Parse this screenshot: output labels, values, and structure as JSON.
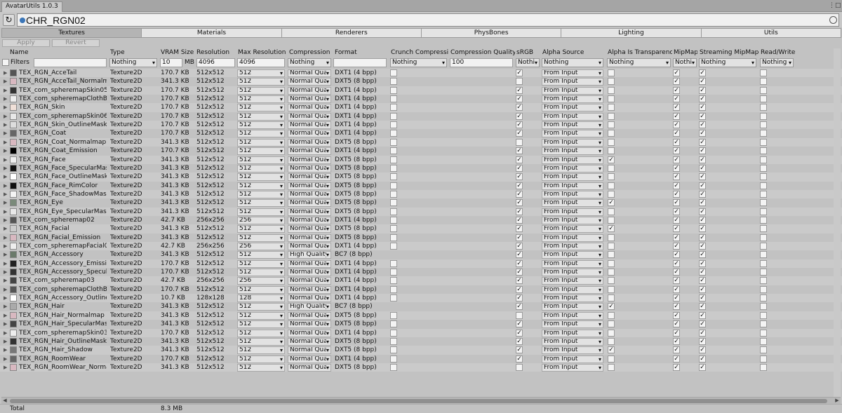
{
  "window": {
    "title": "AvatarUtils 1.0.3",
    "menu_icon": "kebab-menu-icon"
  },
  "toolbar": {
    "refresh_icon": "refresh-icon",
    "object_name": "CHR_RGN02"
  },
  "tabs": [
    "Textures",
    "Materials",
    "Renderers",
    "PhysBones",
    "Lighting",
    "Utils"
  ],
  "actions": {
    "apply": "Apply",
    "revert": "Revert"
  },
  "columns": {
    "name": "Name",
    "type": "Type",
    "vram": "VRAM Size",
    "resolution": "Resolution",
    "max_resolution": "Max Resolution",
    "compression": "Compression",
    "format": "Format",
    "crunch": "Crunch Compression",
    "quality": "Compression Quality",
    "srgb": "sRGB",
    "alpha_source": "Alpha Source",
    "alpha_transparency": "Alpha Is Transparency",
    "mipmap": "MipMap",
    "streaming": "Streaming MipMaps",
    "readwrite": "Read/Write"
  },
  "filters": {
    "label": "Filters",
    "type": "Nothing",
    "vram_value": "10",
    "vram_unit": "MB",
    "resolution": "4096",
    "max_resolution": "4096",
    "compression": "Nothing",
    "crunch": "Nothing",
    "quality": "100",
    "srgb": "Nothi",
    "alpha_source": "Nothing",
    "alpha_transparency": "Nothing",
    "mipmap": "Nothi",
    "streaming": "Nothing",
    "readwrite": "Nothing"
  },
  "rows": [
    {
      "name": "TEX_RGN_AcceTail",
      "type": "Texture2D",
      "vram": "170.7 KB",
      "res": "512x512",
      "max": "512",
      "comp": "Normal Qua",
      "format": "DXT1 (4 bpp)",
      "crunch": false,
      "srgb": true,
      "alpha": "From Input",
      "alphaT": false,
      "mip": true,
      "stream": true,
      "rw": false,
      "thumb": "#555"
    },
    {
      "name": "TEX_RGN_AcceTail_Normalma",
      "type": "Texture2D",
      "vram": "341.3 KB",
      "res": "512x512",
      "max": "512",
      "comp": "Normal Qua",
      "format": "DXT5 (8 bpp)",
      "crunch": false,
      "srgb": false,
      "alpha": "From Input",
      "alphaT": false,
      "mip": true,
      "stream": true,
      "rw": false,
      "thumb": "#d8b8c0"
    },
    {
      "name": "TEX_com_spheremapSkin05",
      "type": "Texture2D",
      "vram": "170.7 KB",
      "res": "512x512",
      "max": "512",
      "comp": "Normal Qua",
      "format": "DXT1 (4 bpp)",
      "crunch": false,
      "srgb": true,
      "alpha": "From Input",
      "alphaT": false,
      "mip": true,
      "stream": true,
      "rw": false,
      "thumb": "#333"
    },
    {
      "name": "TEX_com_spheremapClothBlue",
      "type": "Texture2D",
      "vram": "170.7 KB",
      "res": "512x512",
      "max": "512",
      "comp": "Normal Qua",
      "format": "DXT1 (4 bpp)",
      "crunch": false,
      "srgb": true,
      "alpha": "From Input",
      "alphaT": false,
      "mip": true,
      "stream": true,
      "rw": false,
      "thumb": "#eee"
    },
    {
      "name": "TEX_RGN_Skin",
      "type": "Texture2D",
      "vram": "170.7 KB",
      "res": "512x512",
      "max": "512",
      "comp": "Normal Qua",
      "format": "DXT1 (4 bpp)",
      "crunch": false,
      "srgb": true,
      "alpha": "From Input",
      "alphaT": false,
      "mip": true,
      "stream": true,
      "rw": false,
      "thumb": "#f0e0d8"
    },
    {
      "name": "TEX_com_spheremapSkin06",
      "type": "Texture2D",
      "vram": "170.7 KB",
      "res": "512x512",
      "max": "512",
      "comp": "Normal Qua",
      "format": "DXT1 (4 bpp)",
      "crunch": false,
      "srgb": true,
      "alpha": "From Input",
      "alphaT": false,
      "mip": true,
      "stream": true,
      "rw": false,
      "thumb": "#e8e8e8"
    },
    {
      "name": "TEX_RGN_Skin_OutlineMask",
      "type": "Texture2D",
      "vram": "170.7 KB",
      "res": "512x512",
      "max": "512",
      "comp": "Normal Qua",
      "format": "DXT1 (4 bpp)",
      "crunch": false,
      "srgb": true,
      "alpha": "From Input",
      "alphaT": false,
      "mip": true,
      "stream": true,
      "rw": false,
      "thumb": "#ddd"
    },
    {
      "name": "TEX_RGN_Coat",
      "type": "Texture2D",
      "vram": "170.7 KB",
      "res": "512x512",
      "max": "512",
      "comp": "Normal Qua",
      "format": "DXT1 (4 bpp)",
      "crunch": false,
      "srgb": true,
      "alpha": "From Input",
      "alphaT": false,
      "mip": true,
      "stream": true,
      "rw": false,
      "thumb": "#666"
    },
    {
      "name": "TEX_RGN_Coat_Normalmap",
      "type": "Texture2D",
      "vram": "341.3 KB",
      "res": "512x512",
      "max": "512",
      "comp": "Normal Qua",
      "format": "DXT5 (8 bpp)",
      "crunch": false,
      "srgb": false,
      "alpha": "From Input",
      "alphaT": false,
      "mip": true,
      "stream": true,
      "rw": false,
      "thumb": "#d8b8c0"
    },
    {
      "name": "TEX_RGN_Coat_Emission",
      "type": "Texture2D",
      "vram": "170.7 KB",
      "res": "512x512",
      "max": "512",
      "comp": "Normal Qua",
      "format": "DXT1 (4 bpp)",
      "crunch": false,
      "srgb": true,
      "alpha": "From Input",
      "alphaT": false,
      "mip": true,
      "stream": true,
      "rw": false,
      "thumb": "#000"
    },
    {
      "name": "TEX_RGN_Face",
      "type": "Texture2D",
      "vram": "341.3 KB",
      "res": "512x512",
      "max": "512",
      "comp": "Normal Qua",
      "format": "DXT5 (8 bpp)",
      "crunch": false,
      "srgb": true,
      "alpha": "From Input",
      "alphaT": true,
      "mip": true,
      "stream": true,
      "rw": false,
      "thumb": "#eee"
    },
    {
      "name": "TEX_RGN_Face_SpecularMask",
      "type": "Texture2D",
      "vram": "341.3 KB",
      "res": "512x512",
      "max": "512",
      "comp": "Normal Qua",
      "format": "DXT5 (8 bpp)",
      "crunch": false,
      "srgb": true,
      "alpha": "From Input",
      "alphaT": false,
      "mip": true,
      "stream": true,
      "rw": false,
      "thumb": "#111"
    },
    {
      "name": "TEX_RGN_Face_OutlineMask",
      "type": "Texture2D",
      "vram": "341.3 KB",
      "res": "512x512",
      "max": "512",
      "comp": "Normal Qua",
      "format": "DXT5 (8 bpp)",
      "crunch": false,
      "srgb": true,
      "alpha": "From Input",
      "alphaT": false,
      "mip": true,
      "stream": true,
      "rw": false,
      "thumb": "#fff"
    },
    {
      "name": "TEX_RGN_Face_RimColor",
      "type": "Texture2D",
      "vram": "341.3 KB",
      "res": "512x512",
      "max": "512",
      "comp": "Normal Qua",
      "format": "DXT5 (8 bpp)",
      "crunch": false,
      "srgb": true,
      "alpha": "From Input",
      "alphaT": false,
      "mip": true,
      "stream": true,
      "rw": false,
      "thumb": "#111"
    },
    {
      "name": "TEX_RGN_Face_ShadowMask",
      "type": "Texture2D",
      "vram": "341.3 KB",
      "res": "512x512",
      "max": "512",
      "comp": "Normal Qua",
      "format": "DXT5 (8 bpp)",
      "crunch": false,
      "srgb": true,
      "alpha": "From Input",
      "alphaT": false,
      "mip": true,
      "stream": true,
      "rw": false,
      "thumb": "#f4f4f4"
    },
    {
      "name": "TEX_RGN_Eye",
      "type": "Texture2D",
      "vram": "341.3 KB",
      "res": "512x512",
      "max": "512",
      "comp": "Normal Qua",
      "format": "DXT5 (8 bpp)",
      "crunch": false,
      "srgb": true,
      "alpha": "From Input",
      "alphaT": true,
      "mip": true,
      "stream": true,
      "rw": false,
      "thumb": "#7a8a7a"
    },
    {
      "name": "TEX_RGN_Eye_SpecularMask",
      "type": "Texture2D",
      "vram": "341.3 KB",
      "res": "512x512",
      "max": "512",
      "comp": "Normal Qua",
      "format": "DXT5 (8 bpp)",
      "crunch": false,
      "srgb": true,
      "alpha": "From Input",
      "alphaT": false,
      "mip": true,
      "stream": true,
      "rw": false,
      "thumb": "#e8e8e8"
    },
    {
      "name": "TEX_com_spheremap02",
      "type": "Texture2D",
      "vram": "42.7 KB",
      "res": "256x256",
      "max": "256",
      "comp": "Normal Qua",
      "format": "DXT1 (4 bpp)",
      "crunch": false,
      "srgb": true,
      "alpha": "From Input",
      "alphaT": false,
      "mip": true,
      "stream": true,
      "rw": false,
      "thumb": "#555"
    },
    {
      "name": "TEX_RGN_Facial",
      "type": "Texture2D",
      "vram": "341.3 KB",
      "res": "512x512",
      "max": "512",
      "comp": "Normal Qua",
      "format": "DXT5 (8 bpp)",
      "crunch": false,
      "srgb": true,
      "alpha": "From Input",
      "alphaT": true,
      "mip": true,
      "stream": true,
      "rw": false,
      "thumb": "#ccc"
    },
    {
      "name": "TEX_RGN_Facial_Emission",
      "type": "Texture2D",
      "vram": "341.3 KB",
      "res": "512x512",
      "max": "512",
      "comp": "Normal Qua",
      "format": "DXT5 (8 bpp)",
      "crunch": false,
      "srgb": true,
      "alpha": "From Input",
      "alphaT": false,
      "mip": true,
      "stream": true,
      "rw": false,
      "thumb": "#d8b8c0"
    },
    {
      "name": "TEX_com_spheremapFacial01",
      "type": "Texture2D",
      "vram": "42.7 KB",
      "res": "256x256",
      "max": "256",
      "comp": "Normal Qua",
      "format": "DXT1 (4 bpp)",
      "crunch": false,
      "srgb": true,
      "alpha": "From Input",
      "alphaT": false,
      "mip": true,
      "stream": true,
      "rw": false,
      "thumb": "#eee"
    },
    {
      "name": "TEX_RGN_Accessory",
      "type": "Texture2D",
      "vram": "341.3 KB",
      "res": "512x512",
      "max": "512",
      "comp": "High Quality",
      "format": "BC7 (8 bpp)",
      "crunch": null,
      "srgb": true,
      "alpha": "From Input",
      "alphaT": false,
      "mip": true,
      "stream": true,
      "rw": false,
      "thumb": "#6a7a6a"
    },
    {
      "name": "TEX_RGN_Accessory_Emission",
      "type": "Texture2D",
      "vram": "170.7 KB",
      "res": "512x512",
      "max": "512",
      "comp": "Normal Qua",
      "format": "DXT1 (4 bpp)",
      "crunch": false,
      "srgb": true,
      "alpha": "From Input",
      "alphaT": false,
      "mip": true,
      "stream": true,
      "rw": false,
      "thumb": "#222"
    },
    {
      "name": "TEX_RGN_Accessory_Specular",
      "type": "Texture2D",
      "vram": "170.7 KB",
      "res": "512x512",
      "max": "512",
      "comp": "Normal Qua",
      "format": "DXT1 (4 bpp)",
      "crunch": false,
      "srgb": true,
      "alpha": "From Input",
      "alphaT": false,
      "mip": true,
      "stream": true,
      "rw": false,
      "thumb": "#333"
    },
    {
      "name": "TEX_com_spheremap03",
      "type": "Texture2D",
      "vram": "42.7 KB",
      "res": "256x256",
      "max": "256",
      "comp": "Normal Qua",
      "format": "DXT1 (4 bpp)",
      "crunch": false,
      "srgb": true,
      "alpha": "From Input",
      "alphaT": false,
      "mip": true,
      "stream": true,
      "rw": false,
      "thumb": "#444"
    },
    {
      "name": "TEX_com_spheremapClothBlue",
      "type": "Texture2D",
      "vram": "170.7 KB",
      "res": "512x512",
      "max": "512",
      "comp": "Normal Qua",
      "format": "DXT1 (4 bpp)",
      "crunch": false,
      "srgb": true,
      "alpha": "From Input",
      "alphaT": false,
      "mip": true,
      "stream": true,
      "rw": false,
      "thumb": "#555"
    },
    {
      "name": "TEX_RGN_Accessory_OutlineMa",
      "type": "Texture2D",
      "vram": "10.7 KB",
      "res": "128x128",
      "max": "128",
      "comp": "Normal Qua",
      "format": "DXT1 (4 bpp)",
      "crunch": false,
      "srgb": true,
      "alpha": "From Input",
      "alphaT": false,
      "mip": true,
      "stream": true,
      "rw": false,
      "thumb": "#fff"
    },
    {
      "name": "TEX_RGN_Hair",
      "type": "Texture2D",
      "vram": "341.3 KB",
      "res": "512x512",
      "max": "512",
      "comp": "High Quality",
      "format": "BC7 (8 bpp)",
      "crunch": null,
      "srgb": true,
      "alpha": "From Input",
      "alphaT": true,
      "mip": true,
      "stream": true,
      "rw": false,
      "thumb": "#aaa"
    },
    {
      "name": "TEX_RGN_Hair_Normalmap",
      "type": "Texture2D",
      "vram": "341.3 KB",
      "res": "512x512",
      "max": "512",
      "comp": "Normal Qua",
      "format": "DXT5 (8 bpp)",
      "crunch": false,
      "srgb": false,
      "alpha": "From Input",
      "alphaT": false,
      "mip": true,
      "stream": true,
      "rw": false,
      "thumb": "#d8b8c0"
    },
    {
      "name": "TEX_RGN_Hair_SpecularMask",
      "type": "Texture2D",
      "vram": "341.3 KB",
      "res": "512x512",
      "max": "512",
      "comp": "Normal Qua",
      "format": "DXT5 (8 bpp)",
      "crunch": false,
      "srgb": true,
      "alpha": "From Input",
      "alphaT": false,
      "mip": true,
      "stream": true,
      "rw": false,
      "thumb": "#444"
    },
    {
      "name": "TEX_com_spheremapSkin03",
      "type": "Texture2D",
      "vram": "170.7 KB",
      "res": "512x512",
      "max": "512",
      "comp": "Normal Qua",
      "format": "DXT1 (4 bpp)",
      "crunch": false,
      "srgb": true,
      "alpha": "From Input",
      "alphaT": false,
      "mip": true,
      "stream": true,
      "rw": false,
      "thumb": "#eee"
    },
    {
      "name": "TEX_RGN_Hair_OutlineMask",
      "type": "Texture2D",
      "vram": "341.3 KB",
      "res": "512x512",
      "max": "512",
      "comp": "Normal Qua",
      "format": "DXT5 (8 bpp)",
      "crunch": false,
      "srgb": true,
      "alpha": "From Input",
      "alphaT": false,
      "mip": true,
      "stream": true,
      "rw": false,
      "thumb": "#333"
    },
    {
      "name": "TEX_RGN_Hair_Shadow",
      "type": "Texture2D",
      "vram": "341.3 KB",
      "res": "512x512",
      "max": "512",
      "comp": "Normal Qua",
      "format": "DXT5 (8 bpp)",
      "crunch": false,
      "srgb": true,
      "alpha": "From Input",
      "alphaT": true,
      "mip": true,
      "stream": true,
      "rw": false,
      "thumb": "#777"
    },
    {
      "name": "TEX_RGN_RoomWear",
      "type": "Texture2D",
      "vram": "170.7 KB",
      "res": "512x512",
      "max": "512",
      "comp": "Normal Qua",
      "format": "DXT1 (4 bpp)",
      "crunch": false,
      "srgb": true,
      "alpha": "From Input",
      "alphaT": false,
      "mip": true,
      "stream": true,
      "rw": false,
      "thumb": "#666"
    },
    {
      "name": "TEX_RGN_RoomWear_Normalr",
      "type": "Texture2D",
      "vram": "341.3 KB",
      "res": "512x512",
      "max": "512",
      "comp": "Normal Qua",
      "format": "DXT5 (8 bpp)",
      "crunch": false,
      "srgb": false,
      "alpha": "From Input",
      "alphaT": false,
      "mip": true,
      "stream": true,
      "rw": false,
      "thumb": "#d8b8c0"
    }
  ],
  "footer": {
    "label": "Total",
    "value": "8.3 MB"
  }
}
